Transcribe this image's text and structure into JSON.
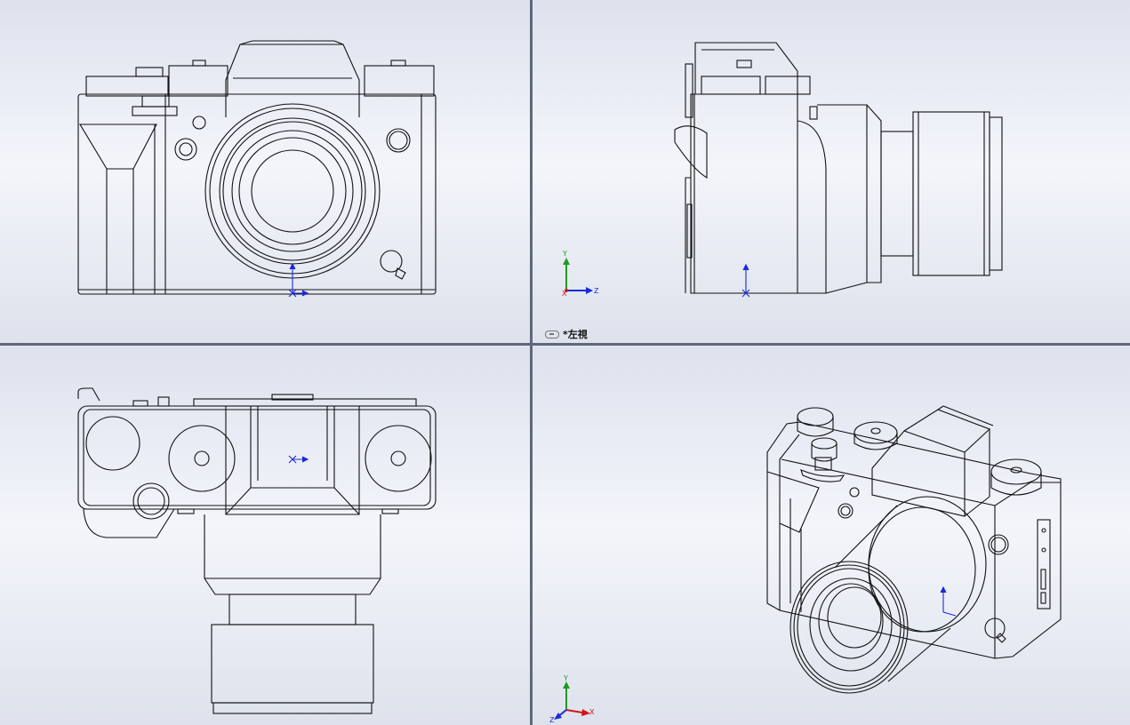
{
  "viewports": {
    "top_left": {
      "name": "front-view"
    },
    "top_right": {
      "name": "left-view",
      "label": "*左視"
    },
    "bottom_left": {
      "name": "top-view"
    },
    "bottom_right": {
      "name": "isometric-view"
    }
  },
  "triad": {
    "x": "X",
    "y": "Y",
    "z": "Z"
  },
  "colors": {
    "background_top": "#dde2ee",
    "background_mid": "#f3f5fa",
    "splitter": "#5f6878",
    "line": "#111111",
    "axis_x": "#d01818",
    "axis_y": "#1f9a1f",
    "axis_z": "#1a2bd6"
  },
  "icons": [
    "link-icon",
    "triad-icon",
    "origin-icon"
  ]
}
